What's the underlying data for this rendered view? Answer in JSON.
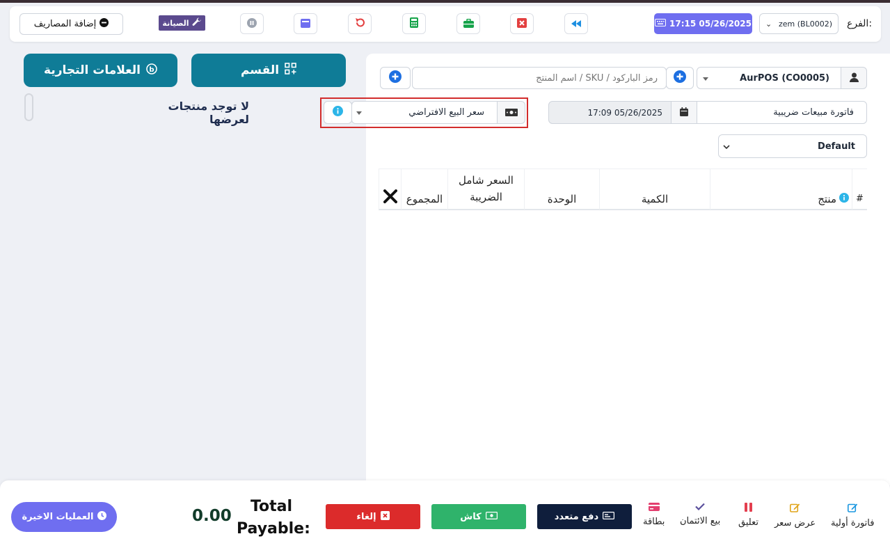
{
  "header": {
    "branch_label": "الفرع:",
    "branch_value": "zem (BL0002)",
    "datetime": "17:15 05/26/2025",
    "maintenance_label": "الصيانة",
    "add_expense_label": "إضافة المصاريف"
  },
  "left_panel": {
    "category_label": "القسم",
    "brands_label": "العلامات التجارية",
    "no_products": "لا توجد منتجات لعرضها"
  },
  "pos": {
    "customer": "AurPOS (CO0005)",
    "search_placeholder": "اسم المنتج / SKU / رمز الباركود",
    "invoice_type": "فاتورة مبيعات ضريبية",
    "transaction_date": "17:09 05/26/2025",
    "price_group": "سعر البيع الافتراضي",
    "service_type": "Default",
    "table_headers": {
      "hash": "#",
      "product": "منتج",
      "quantity": "الكمية",
      "unit": "الوحدة",
      "price_incl_tax": "السعر شامل الضريبة",
      "total": "المجموع",
      "remove": "✕"
    }
  },
  "footer": {
    "draft": "فاتورة أولية",
    "quotation": "عرض سعر",
    "suspend": "تعليق",
    "credit_sale": "بيع الائتمان",
    "card": "بطاقة",
    "multiple_pay": "دفع متعدد",
    "cash": "كاش",
    "cancel": "إلغاء",
    "total_payable_label": "Total Payable:",
    "total_payable_value": "0.00",
    "recent_transactions": "العمليات الاخيرة"
  },
  "colors": {
    "primary_teal": "#0f7c97",
    "accent_purple": "#6f6ef0",
    "cash_green": "#2fb36b",
    "cancel_red": "#dc2b2b",
    "navy": "#0f1e3c",
    "highlight_red": "#d22c2c"
  }
}
